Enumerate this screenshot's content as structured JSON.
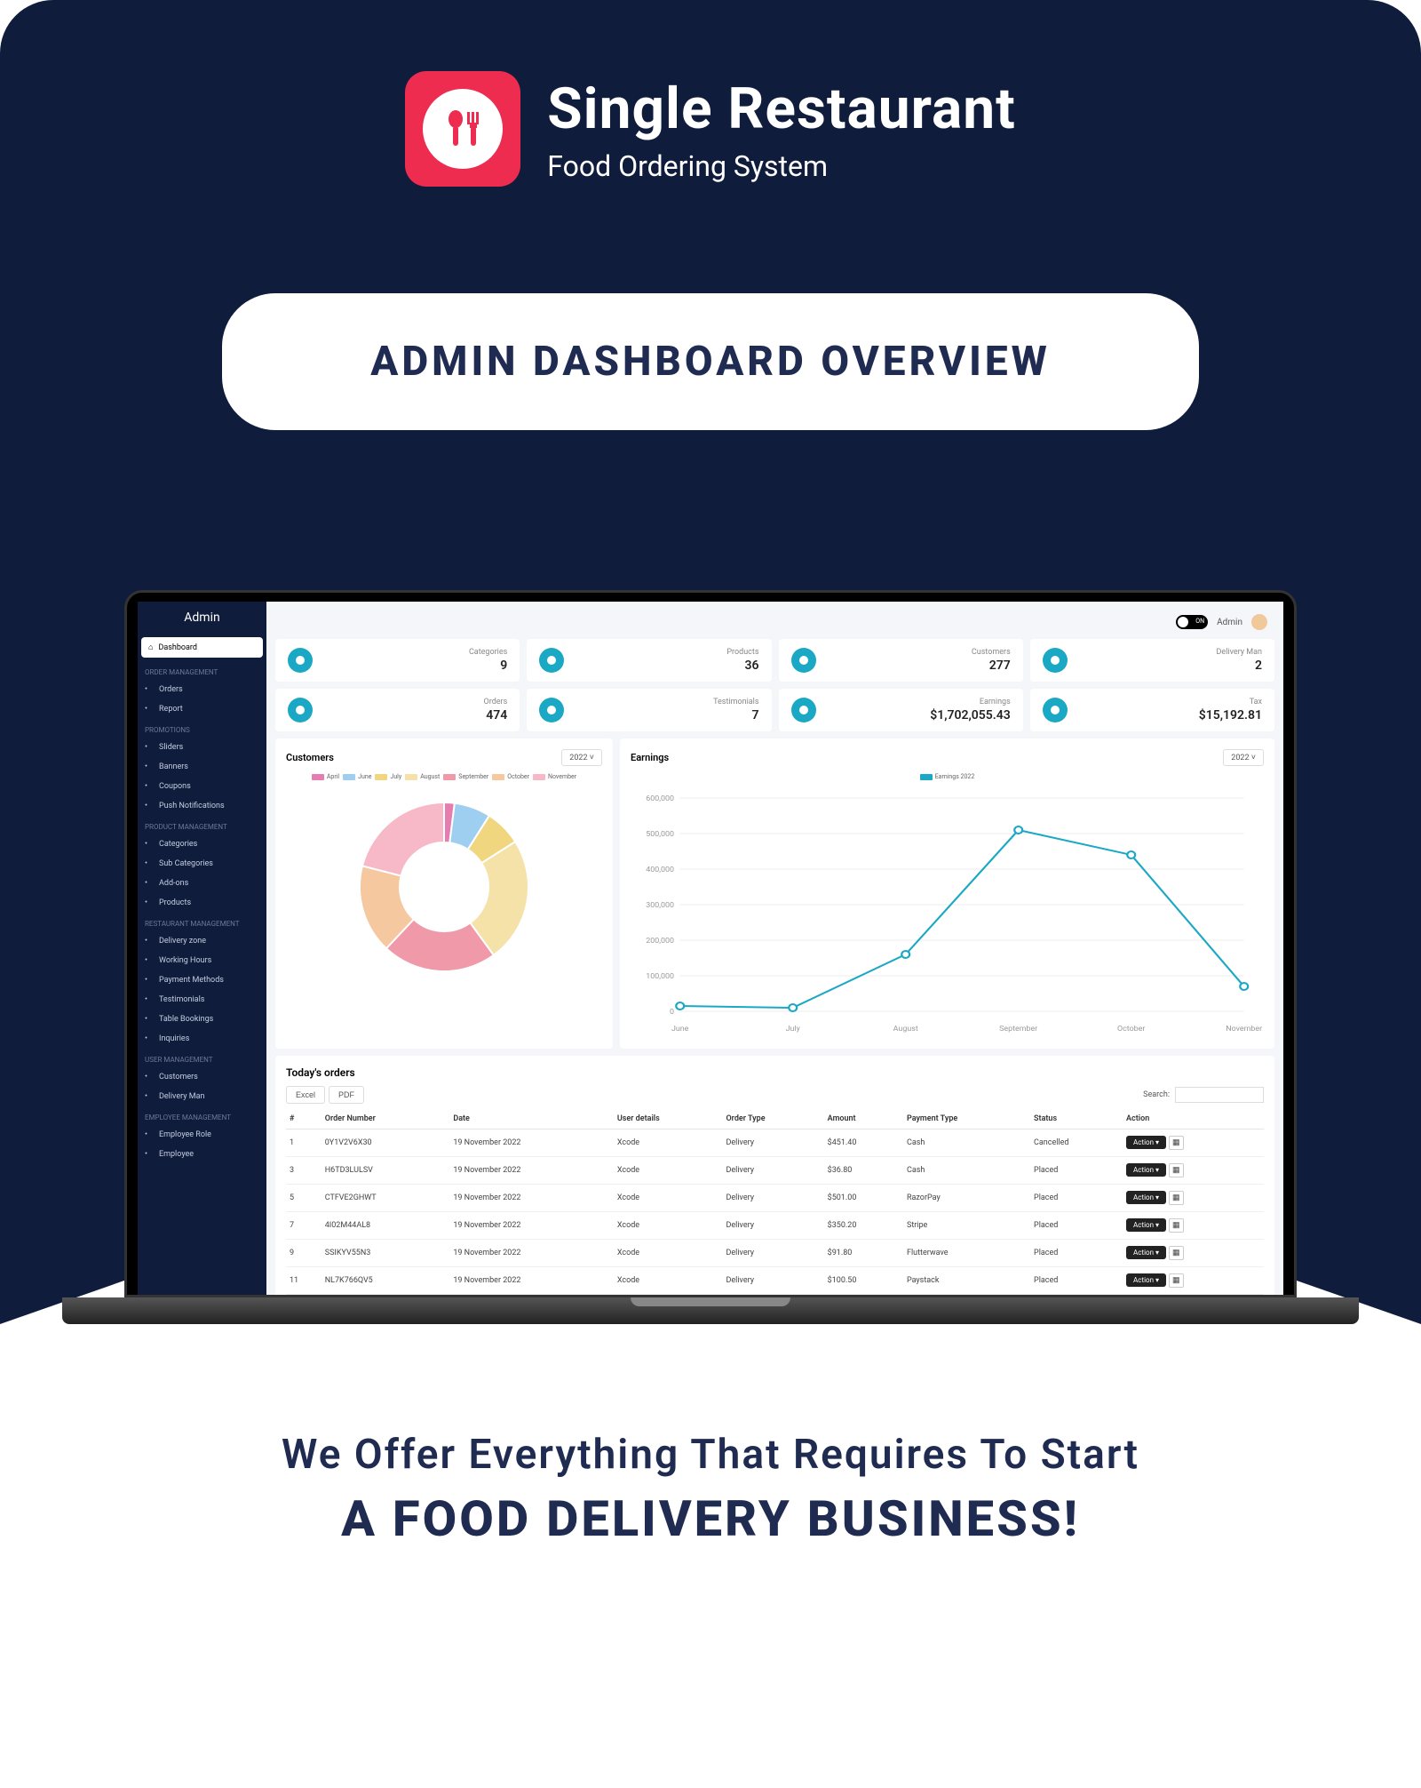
{
  "brand": {
    "title": "Single Restaurant",
    "subtitle": "Food Ordering System"
  },
  "overview_heading": "ADMIN DASHBOARD OVERVIEW",
  "sidebar": {
    "title": "Admin",
    "active": "Dashboard",
    "sections": [
      {
        "heading": "ORDER MANAGEMENT",
        "items": [
          "Orders",
          "Report"
        ]
      },
      {
        "heading": "PROMOTIONS",
        "items": [
          "Sliders",
          "Banners",
          "Coupons",
          "Push Notifications"
        ]
      },
      {
        "heading": "PRODUCT MANAGEMENT",
        "items": [
          "Categories",
          "Sub Categories",
          "Add-ons",
          "Products"
        ]
      },
      {
        "heading": "RESTAURANT MANAGEMENT",
        "items": [
          "Delivery zone",
          "Working Hours",
          "Payment Methods",
          "Testimonials",
          "Table Bookings",
          "Inquiries"
        ]
      },
      {
        "heading": "USER MANAGEMENT",
        "items": [
          "Customers",
          "Delivery Man"
        ]
      },
      {
        "heading": "EMPLOYEE MANAGEMENT",
        "items": [
          "Employee Role",
          "Employee"
        ]
      }
    ]
  },
  "topbar": {
    "toggle": "ON",
    "user": "Admin"
  },
  "stats": [
    {
      "label": "Categories",
      "value": "9"
    },
    {
      "label": "Products",
      "value": "36"
    },
    {
      "label": "Customers",
      "value": "277"
    },
    {
      "label": "Delivery Man",
      "value": "2"
    },
    {
      "label": "Orders",
      "value": "474"
    },
    {
      "label": "Testimonials",
      "value": "7"
    },
    {
      "label": "Earnings",
      "value": "$1,702,055.43"
    },
    {
      "label": "Tax",
      "value": "$15,192.81"
    }
  ],
  "customers_chart": {
    "title": "Customers",
    "year": "2022"
  },
  "earnings_chart": {
    "title": "Earnings",
    "year": "2022",
    "legend": "Earnings 2022"
  },
  "chart_data": [
    {
      "type": "pie",
      "title": "Customers",
      "categories": [
        "April",
        "June",
        "July",
        "August",
        "September",
        "October",
        "November"
      ],
      "values": [
        2,
        7,
        7,
        24,
        22,
        17,
        21
      ],
      "colors": [
        "#e57db0",
        "#9ecff0",
        "#f0d67e",
        "#f5e2a8",
        "#f099a8",
        "#f5c8a0",
        "#f7b8c8"
      ]
    },
    {
      "type": "line",
      "title": "Earnings",
      "series": [
        {
          "name": "Earnings 2022",
          "values": [
            15000,
            10000,
            160000,
            510000,
            440000,
            70000
          ]
        }
      ],
      "categories": [
        "June",
        "July",
        "August",
        "September",
        "October",
        "November"
      ],
      "ylabel": "",
      "ylim": [
        0,
        600000
      ],
      "yticks": [
        0,
        100000,
        200000,
        300000,
        400000,
        500000,
        600000
      ]
    }
  ],
  "orders_table": {
    "title": "Today's orders",
    "export": [
      "Excel",
      "PDF"
    ],
    "search_label": "Search:",
    "columns": [
      "#",
      "Order Number",
      "Date",
      "User details",
      "Order Type",
      "Amount",
      "Payment Type",
      "Status",
      "Action"
    ],
    "rows": [
      {
        "n": "1",
        "num": "0Y1V2V6X30",
        "date": "19 November 2022",
        "user": "Xcode",
        "type": "Delivery",
        "amt": "$451.40",
        "pay": "Cash",
        "status": "Cancelled",
        "action": "Action"
      },
      {
        "n": "3",
        "num": "H6TD3LULSV",
        "date": "19 November 2022",
        "user": "Xcode",
        "type": "Delivery",
        "amt": "$36.80",
        "pay": "Cash",
        "status": "Placed",
        "action": "Action"
      },
      {
        "n": "5",
        "num": "CTFVE2GHWT",
        "date": "19 November 2022",
        "user": "Xcode",
        "type": "Delivery",
        "amt": "$501.00",
        "pay": "RazorPay",
        "status": "Placed",
        "action": "Action"
      },
      {
        "n": "7",
        "num": "4I02M44AL8",
        "date": "19 November 2022",
        "user": "Xcode",
        "type": "Delivery",
        "amt": "$350.20",
        "pay": "Stripe",
        "status": "Placed",
        "action": "Action"
      },
      {
        "n": "9",
        "num": "SSIKYV55N3",
        "date": "19 November 2022",
        "user": "Xcode",
        "type": "Delivery",
        "amt": "$91.80",
        "pay": "Flutterwave",
        "status": "Placed",
        "action": "Action"
      },
      {
        "n": "11",
        "num": "NL7K766QV5",
        "date": "19 November 2022",
        "user": "Xcode",
        "type": "Delivery",
        "amt": "$100.50",
        "pay": "Paystack",
        "status": "Placed",
        "action": "Action"
      }
    ]
  },
  "footer": {
    "line1": "We Offer Everything That Requires To Start",
    "line2": "A FOOD DELIVERY BUSINESS!"
  }
}
